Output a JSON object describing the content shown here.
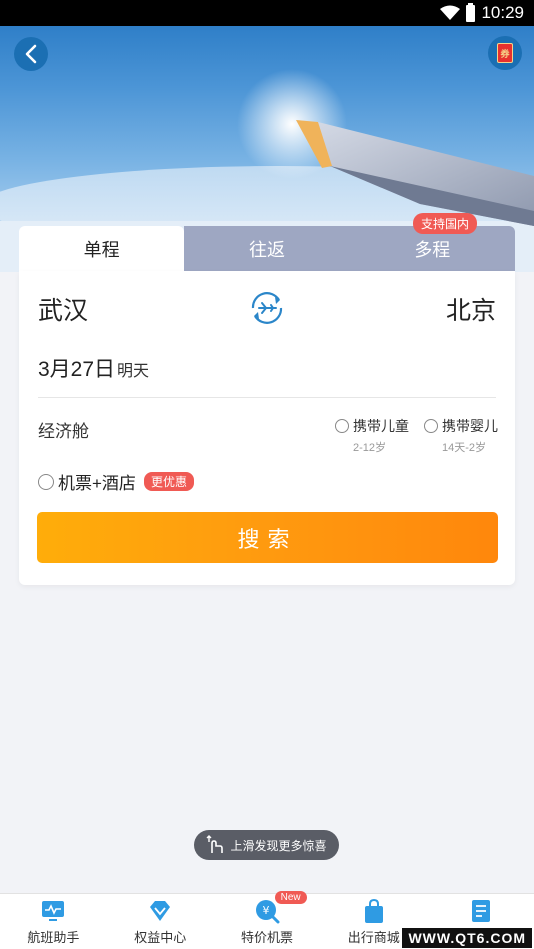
{
  "status_bar": {
    "time": "10:29"
  },
  "hero": {
    "coupon_icon_text": "券"
  },
  "tabs": [
    {
      "label": "单程",
      "active": true
    },
    {
      "label": "往返",
      "active": false
    },
    {
      "label": "多程",
      "active": false,
      "badge": "支持国内"
    }
  ],
  "route": {
    "from": "武汉",
    "to": "北京"
  },
  "date": {
    "main": "3月27日",
    "sub": "明天"
  },
  "cabin": "经济舱",
  "options": [
    {
      "label": "携带儿童",
      "sub": "2-12岁"
    },
    {
      "label": "携带婴儿",
      "sub": "14天-2岁"
    }
  ],
  "hotel": {
    "label": "机票+酒店",
    "badge": "更优惠"
  },
  "search_label": "搜索",
  "swipe_hint": "上滑发现更多惊喜",
  "bottom_nav": [
    {
      "label": "航班助手",
      "icon": "monitor-icon"
    },
    {
      "label": "权益中心",
      "icon": "diamond-icon"
    },
    {
      "label": "特价机票",
      "icon": "yen-search-icon",
      "badge": "New"
    },
    {
      "label": "出行商城",
      "icon": "shopping-bag-icon"
    },
    {
      "label": "",
      "icon": "list-icon"
    }
  ],
  "watermark": "WWW.QT6.COM",
  "colors": {
    "accent_blue": "#1b6fb3",
    "search_start": "#ffad0a",
    "search_end": "#ff870c",
    "badge_red": "#f05a54"
  }
}
